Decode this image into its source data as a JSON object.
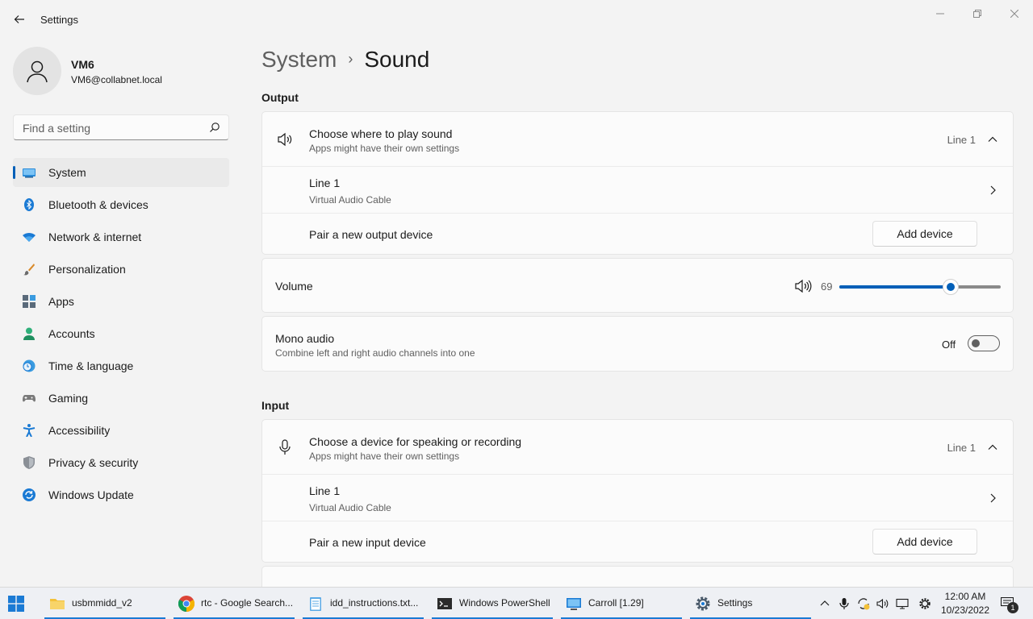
{
  "window": {
    "title": "Settings"
  },
  "profile": {
    "name": "VM6",
    "email": "VM6@collabnet.local"
  },
  "search": {
    "placeholder": "Find a setting"
  },
  "sidebar": {
    "items": [
      {
        "label": "System",
        "icon": "system-icon",
        "active": true
      },
      {
        "label": "Bluetooth & devices",
        "icon": "bluetooth-icon"
      },
      {
        "label": "Network & internet",
        "icon": "wifi-icon"
      },
      {
        "label": "Personalization",
        "icon": "brush-icon"
      },
      {
        "label": "Apps",
        "icon": "apps-icon"
      },
      {
        "label": "Accounts",
        "icon": "accounts-icon"
      },
      {
        "label": "Time & language",
        "icon": "clock-globe-icon"
      },
      {
        "label": "Gaming",
        "icon": "gamepad-icon"
      },
      {
        "label": "Accessibility",
        "icon": "accessibility-icon"
      },
      {
        "label": "Privacy & security",
        "icon": "shield-icon"
      },
      {
        "label": "Windows Update",
        "icon": "update-icon"
      }
    ]
  },
  "breadcrumb": {
    "parent": "System",
    "separator": "›",
    "current": "Sound"
  },
  "output": {
    "heading": "Output",
    "choose": {
      "title": "Choose where to play sound",
      "subtitle": "Apps might have their own settings",
      "value": "Line 1"
    },
    "device": {
      "title": "Line 1",
      "subtitle": "Virtual Audio Cable"
    },
    "pair": {
      "title": "Pair a new output device",
      "button": "Add device"
    },
    "volume": {
      "label": "Volume",
      "value": "69",
      "level": 0.69
    },
    "mono": {
      "title": "Mono audio",
      "subtitle": "Combine left and right audio channels into one",
      "state": "Off"
    }
  },
  "input": {
    "heading": "Input",
    "choose": {
      "title": "Choose a device for speaking or recording",
      "subtitle": "Apps might have their own settings",
      "value": "Line 1"
    },
    "device": {
      "title": "Line 1",
      "subtitle": "Virtual Audio Cable"
    },
    "pair": {
      "title": "Pair a new input device",
      "button": "Add device"
    }
  },
  "taskbar": {
    "apps": [
      {
        "label": "usbmmidd_v2",
        "icon": "folder-icon"
      },
      {
        "label": "rtc - Google Search...",
        "icon": "chrome-icon"
      },
      {
        "label": "idd_instructions.txt...",
        "icon": "notepad-icon"
      },
      {
        "label": "Windows PowerShell",
        "icon": "powershell-icon"
      },
      {
        "label": "Carroll [1.29]",
        "icon": "remote-desktop-icon"
      },
      {
        "label": "Settings",
        "icon": "settings-icon"
      }
    ],
    "time": "12:00 AM",
    "date": "10/23/2022",
    "notification_count": "1"
  },
  "colors": {
    "accent": "#005fb8",
    "background": "#f3f3f3",
    "card": "#fbfbfb"
  }
}
